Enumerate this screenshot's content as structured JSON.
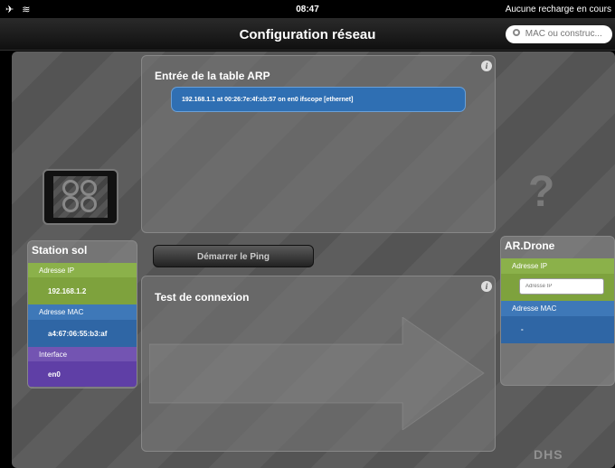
{
  "statusbar": {
    "airplane_icon": "airplane-icon",
    "wifi_icon": "wifi-icon",
    "time": "08:47",
    "battery_text": "Aucune recharge en cours"
  },
  "navbar": {
    "title": "Configuration réseau",
    "search_placeholder": "MAC ou construc..."
  },
  "arp": {
    "title": "Entrée de la table ARP",
    "entry": "192.168.1.1 at 00:26:7e:4f:cb:57 on en0 ifscope [ethernet]"
  },
  "ping": {
    "button_label": "Démarrer le Ping"
  },
  "test": {
    "title": "Test de connexion"
  },
  "ground_station": {
    "title": "Station sol",
    "ip_label": "Adresse IP",
    "ip_value": "192.168.1.2",
    "mac_label": "Adresse MAC",
    "mac_value": "a4:67:06:55:b3:af",
    "iface_label": "Interface",
    "iface_value": "en0"
  },
  "drone": {
    "title": "AR.Drone",
    "ip_label": "Adresse IP",
    "ip_placeholder": "Adresse IP",
    "mac_label": "Adresse MAC",
    "mac_value": "-",
    "unknown_symbol": "?"
  },
  "watermark": "DHS"
}
